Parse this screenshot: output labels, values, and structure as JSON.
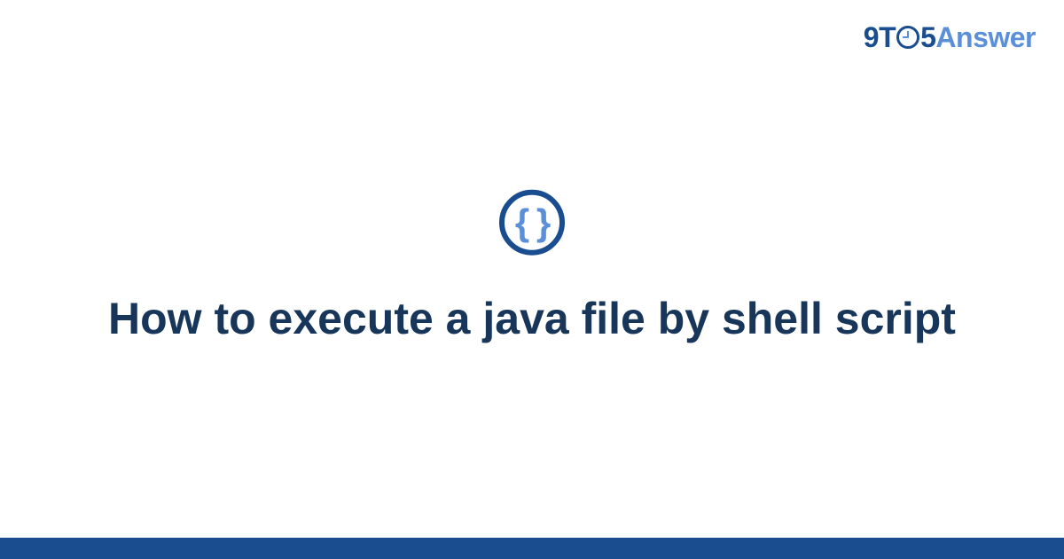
{
  "logo": {
    "part1": "9",
    "part2": "T",
    "part3": "5",
    "part4": "Answer"
  },
  "icon": {
    "glyph": "{ }"
  },
  "title": "How to execute a java file by shell script"
}
